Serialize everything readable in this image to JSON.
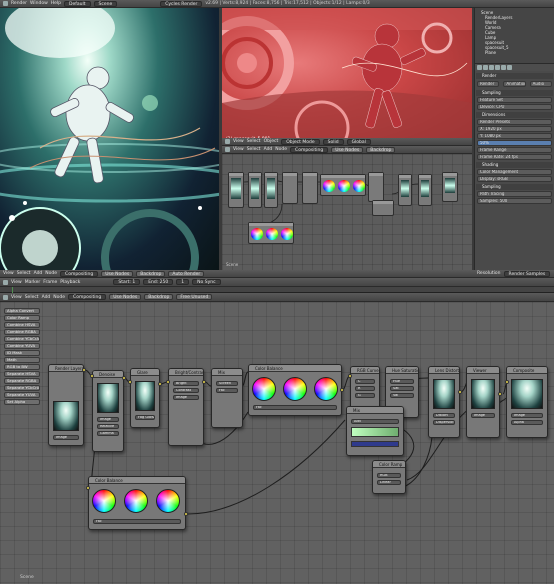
{
  "top_header": {
    "left": {
      "menus": [
        "Render",
        "Window",
        "Help"
      ],
      "layout": "Default",
      "scene": "Scene"
    },
    "right": {
      "engine": "Cycles Render",
      "info": "v2.69 | Verts:8,924 | Faces:8,756 | Tris:17,512 | Objects:1/12 | Lamps:0/3"
    }
  },
  "render_view": {
    "header": {
      "menus": [
        "View",
        "Image"
      ],
      "image": "Render Result",
      "slot": "Slot 1",
      "layer": "RenderLayer",
      "pass": "Composite"
    }
  },
  "viewport": {
    "header": {
      "menus": [
        "View",
        "Select",
        "Object"
      ],
      "mode": "Object Mode",
      "shading": "Solid",
      "space": "Global"
    },
    "label": "(1) spacesuit_5.001"
  },
  "small_node_editor": {
    "header": {
      "menus": [
        "View",
        "Select",
        "Add",
        "Node"
      ],
      "tree": "Compositing",
      "use_nodes": "Use Nodes",
      "backdrop": "Backdrop"
    },
    "footer": "Scene"
  },
  "properties": {
    "outliner_rows": [
      "Scene",
      "RenderLayers",
      "World",
      "Camera",
      "Cube",
      "Lamp",
      "spacesuit",
      "spacesuit_5",
      "Plane"
    ],
    "sections": [
      {
        "title": "Render",
        "rows": [
          "Render",
          "Animation",
          "Audio"
        ]
      },
      {
        "title": "Sampling",
        "rows": [
          "Feature Set",
          "Device: CPU"
        ]
      },
      {
        "title": "Dimensions",
        "rows": [
          "Render Presets",
          "X: 1920 px",
          "Y: 1080 px",
          "50%",
          "Frame Range",
          "Frame Rate: 24 fps"
        ]
      },
      {
        "title": "Shading",
        "rows": [
          "Color Management",
          "Display: sRGB"
        ]
      },
      {
        "title": "Sampling",
        "rows": [
          "Path Tracing",
          "Samples: 500"
        ]
      }
    ],
    "bottom": {
      "label": "Resolution",
      "value": "Render Samples"
    }
  },
  "render_bottom_bar": {
    "items": [
      "View",
      "Select",
      "Add",
      "Node",
      "Compositing",
      "Use Nodes",
      "Backdrop",
      "Auto Render"
    ]
  },
  "timeline_header": {
    "items": [
      "View",
      "Marker",
      "Frame",
      "Playback",
      "Start: 1",
      "End: 250",
      "1",
      "No Sync"
    ]
  },
  "node_editor_header": {
    "items": [
      "View",
      "Select",
      "Add",
      "Node"
    ],
    "tree": "Compositing",
    "use_nodes": "Use Nodes",
    "backdrop": "Backdrop",
    "free_unused": "Free Unused"
  },
  "node_editor": {
    "toolshelf": [
      "Alpha Convert",
      "Color Ramp",
      "Combine HSVA",
      "Combine RGBA",
      "Combine YCbCrA",
      "Combine YUVA",
      "ID Mask",
      "Math",
      "RGB to BW",
      "Separate HSVA",
      "Separate RGBA",
      "Separate YCbCrA",
      "Separate YUVA",
      "Set Alpha"
    ],
    "nodes": [
      {
        "id": "n1",
        "title": "Render Layers",
        "fields": [
          "Image",
          "Alpha",
          "Z",
          "Normal"
        ]
      },
      {
        "id": "n2",
        "title": "Denoise",
        "fields": [
          "Image",
          "Relative",
          "Gamma"
        ]
      },
      {
        "id": "n3",
        "title": "Glare",
        "fields": [
          "Fog Glow",
          "High",
          "Image"
        ]
      },
      {
        "id": "n4",
        "title": "Bright/Contrast",
        "fields": [
          "Bright",
          "Contrast",
          "Image"
        ]
      },
      {
        "id": "n5",
        "title": "Color Balance",
        "fields": [
          "Lift/Gamma/Gain",
          "Fac",
          "Image"
        ]
      },
      {
        "id": "n6",
        "title": "Mix",
        "fields": [
          "Screen",
          "Fac",
          "Image"
        ]
      },
      {
        "id": "n7",
        "title": "RGB Curves",
        "fields": [
          "C",
          "R",
          "G",
          "B"
        ]
      },
      {
        "id": "n8",
        "title": "Hue Saturation Value",
        "fields": [
          "Hue",
          "Sat",
          "Val"
        ]
      },
      {
        "id": "n9",
        "title": "Lens Distortion",
        "fields": [
          "Distort",
          "Dispersion",
          "Image"
        ]
      },
      {
        "id": "n10",
        "title": "Viewer",
        "fields": [
          "Image",
          "Alpha"
        ]
      },
      {
        "id": "n11",
        "title": "Composite",
        "fields": [
          "Image",
          "Alpha",
          "Z"
        ]
      },
      {
        "id": "n12",
        "title": "Color Balance",
        "fields": [
          "Lift/Gamma/Gain",
          "Fac",
          "Image"
        ]
      },
      {
        "id": "n13",
        "title": "Mix",
        "fields": [
          "Add",
          "Fac",
          "Image"
        ]
      },
      {
        "id": "n14",
        "title": "Color Ramp",
        "fields": [
          "RGB",
          "Linear",
          "Fac"
        ]
      }
    ],
    "footer": "Scene"
  }
}
